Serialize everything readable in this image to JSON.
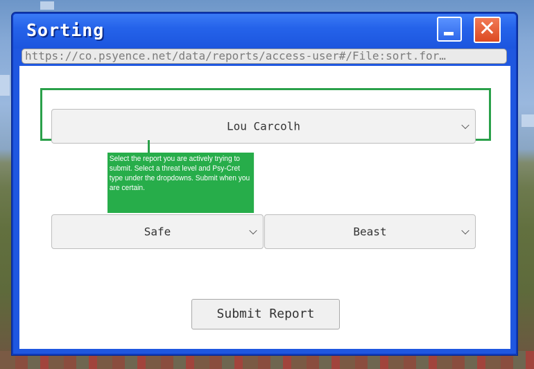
{
  "window": {
    "title": "Sorting",
    "close_glyph": "✕"
  },
  "address_bar": {
    "url": "https://co.psyence.net/data/reports/access-user#/File:sort.for…"
  },
  "form": {
    "report_select": {
      "value": "Lou Carcolh"
    },
    "threat_select": {
      "value": "Safe"
    },
    "type_select": {
      "value": "Beast"
    },
    "tooltip": {
      "text": "Select the report you are actively trying to submit. Select a threat level and Psy-Cret type under the dropdowns. Submit when you are certain."
    },
    "submit_label": "Submit Report"
  },
  "colors": {
    "window_blue": "#1f57e0",
    "highlight_green": "#2aa04a",
    "tooltip_green": "#27ad4a",
    "close_red": "#dc4a22"
  },
  "icons": {
    "minimize": "minimize-icon",
    "close": "close-icon",
    "dropdown": "chevron-down-icon"
  }
}
